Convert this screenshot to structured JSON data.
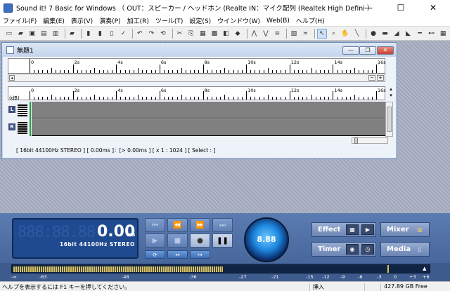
{
  "window": {
    "title": "Sound it! 7 Basic for Windows （ OUT：スピーカー / ヘッドホン (Realte  IN：マイク配列 (Realtek High Defini ）",
    "minimize": "—",
    "maximize": "☐",
    "close": "✕"
  },
  "menu": [
    "ファイル(F)",
    "編集(E)",
    "表示(V)",
    "演奏(P)",
    "加工(R)",
    "ツール(T)",
    "設定(S)",
    "ウインドウ(W)",
    "Web(B)",
    "ヘルプ(H)"
  ],
  "document": {
    "title": "無題1",
    "minimize": "—",
    "restore": "❐",
    "close": "✕",
    "ruler_ticks": [
      "0",
      "2s",
      "4s",
      "6s",
      "8s",
      "10s",
      "12s",
      "14s",
      "16s"
    ],
    "db_label": "(dB)",
    "track_left": "L",
    "track_right": "R",
    "status_text": "[ 16bit   44100Hz   STEREO ]  [ 0.00ms ]：[> 0.00ms ]  [ x 1 : 1024 ]  [ Select : ]"
  },
  "transport": {
    "lcd_segments": "888:88.88",
    "time": "0.00",
    "unit": "ms",
    "format": "16bit   44100Hz STEREO",
    "knob": "8.88",
    "effect": "Effect",
    "timer": "Timer",
    "mixer": "Mixer",
    "media": "Media"
  },
  "meter": {
    "scale": [
      "-∞",
      "-63",
      "-48",
      "-36",
      "-27",
      "-21",
      "-15",
      "-12",
      "-9",
      "-6",
      "-3",
      "0",
      "+3",
      "+6"
    ],
    "level": 0.5
  },
  "statusbar": {
    "help": "ヘルプを表示するには F1 キーを押してください。",
    "mode": "挿入",
    "free": "427.89 GB Free"
  }
}
